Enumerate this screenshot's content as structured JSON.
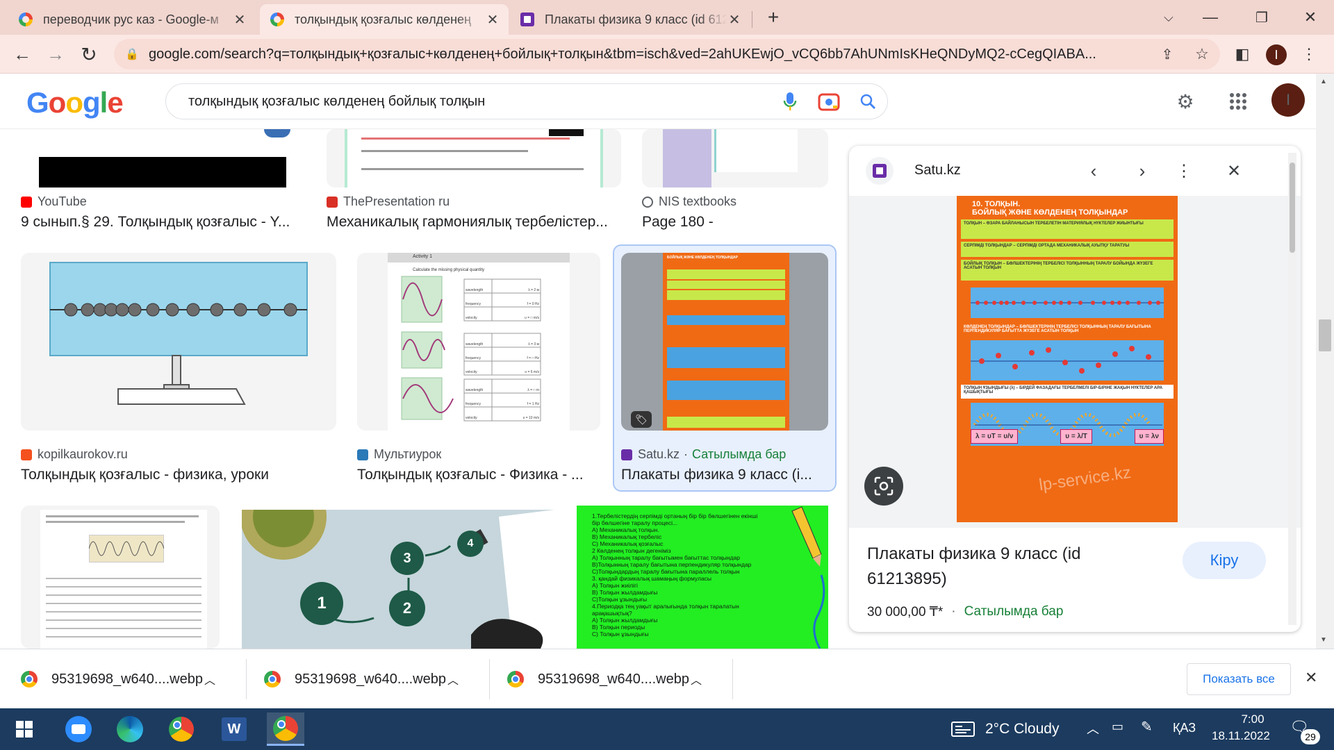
{
  "tabs": [
    {
      "title": "переводчик рус каз - Google-м",
      "active": false
    },
    {
      "title": "толқындық қозғалыс көлденең",
      "active": true
    },
    {
      "title": "Плакаты физика 9 класс (id 612",
      "active": false
    }
  ],
  "toolbar": {
    "url": "google.com/search?q=толқындық+қозғалыс+көлденең+бойлық+толқын&tbm=isch&ved=2ahUKEwjO_vCQ6bb7AhUNmIsKHeQNDyMQ2-cCegQIABA...",
    "profile_initial": "I"
  },
  "google": {
    "logo": [
      "G",
      "o",
      "o",
      "g",
      "l",
      "e"
    ],
    "logo_colors": [
      "#4285f4",
      "#ea4335",
      "#fbbc05",
      "#4285f4",
      "#34a853",
      "#ea4335"
    ],
    "query": "толқындық қозғалыс көлденең бойлық толқын",
    "profile_initial": "I"
  },
  "results_row1": [
    {
      "source": "YouTube",
      "caption": "9 сынып.§ 29. Толқындық қозғалыс - Y..."
    },
    {
      "source": "ThePresentation ru",
      "caption": "Механикалық гармониялық тербелістер..."
    },
    {
      "source": "NIS textbooks",
      "caption": "Page 180 -"
    }
  ],
  "results_row2": [
    {
      "source": "kopilkaurokov.ru",
      "caption": "Толқындық қозғалыс - физика, уроки"
    },
    {
      "source": "Мультиурок",
      "caption": "Толқындық қозғалыс - Физика - ..."
    },
    {
      "source": "Satu.kz",
      "source_extra": "Сатылымда бар",
      "caption": "Плакаты физика 9 класс (i..."
    }
  ],
  "thumb2": {
    "activity": "Activity 1",
    "instruction": "Calculate the missing physical quantity",
    "rows": [
      [
        "wavelength",
        "λ = 2 м"
      ],
      [
        "frequency",
        "f = 0 Hz"
      ],
      [
        "velocity",
        "υ = □ m/s"
      ],
      [
        "wavelength",
        "λ = 3 м"
      ],
      [
        "frequency",
        "f = □ Hz"
      ],
      [
        "velocity",
        "υ = 6 m/s"
      ],
      [
        "wavelength",
        "λ = □ m"
      ],
      [
        "frequency",
        "f = 1 Hz"
      ],
      [
        "velocity",
        "υ = 10 m/s"
      ]
    ]
  },
  "thumb3": {
    "lines": [
      "1.Тербелістердің серпімді ортаның бір бір бөлшегінен екінші",
      "бір бөлшегіне таралу процесі...",
      "А) Механикалық толқын.",
      "B) Механикалық тербеліс",
      "C) Механикалық қозғалыс",
      "2 Көлденең толқын дегеніміз",
      "A)  Толқынның таралу бағытымен бағыттас толқындар",
      "B)Толқынның таралу бағытына перпендикуляр толқындар",
      "C)Толқындардың таралу бағытына параллель толқын",
      "3. қандай физикалық шамаңың формуласы",
      "A) Толқын жиілігі",
      "B) Толқын жылдамдығы",
      "C)Толқын ұзындығы",
      "4.Периодқа тең уақыт аралығында толқын таралатын",
      "арақашықтық?",
      "A) Толқын  жылдамдығы",
      "B) Толқын периоды",
      "C) Толқын ұзындығы"
    ]
  },
  "diagram_numbers": [
    "1",
    "2",
    "3",
    "4"
  ],
  "poster": {
    "title1": "10. ТОЛҚЫН.",
    "title2": "БОЙЛЫҚ ЖӘНЕ КӨЛДЕНЕҢ ТОЛҚЫНДАР",
    "def1": "ТОЛҚЫН – ӨЗАРА БАЙЛАНЫСЫН ТЕРБЕЛЕТІН МАТЕРИЯЛЫҚ НҮКТЕЛЕР ЖИЫНТЫҒЫ",
    "def2": "СЕРПІМДІ ТОЛҚЫНДАР – СЕРПІМДІ ОРТАДА МЕХАНИКАЛЫҚ АУЫТҚУ ТАРАТУЫ",
    "def3": "БОЙЛЫҚ ТОЛҚЫН – БӨЛШЕКТЕРІНІҢ ТЕРБЕЛІСІ ТОЛҚЫННЫҢ ТАРАЛУ БОЙЫНДА ЖҮЗЕГЕ АСАТЫН ТОЛҚЫН",
    "def4": "КӨЛДЕНЕҢ ТОЛҚЫНДАР – БӨЛШЕКТЕРІНІҢ ТЕРБЕЛІСІ ТОЛҚЫННЫҢ ТАРАЛУ БАҒЫТЫНА ПЕРПЕНДИКУЛЯР БАҒЫТТА ЖҮЗЕГЕ АСАТЫН ТОЛҚЫН",
    "def5": "ТОЛҚЫН ҰЗЫНДЫҒЫ (λ) – БІРДЕЙ ФАЗАДАҒЫ ТЕРБЕЛМЕЛІ БІР-БІРІНЕ ЖАҚЫН НҮКТЕЛЕР АРА ҚАШЫҚТЫҒЫ",
    "f1": "λ = υT = υ/ν",
    "f2": "υ = λ/T",
    "f3": "υ = λν",
    "watermark": "lp-service.kz"
  },
  "panel": {
    "site": "Satu.kz",
    "title": "Плакаты физика 9 класс (id 61213895)",
    "price": "30 000,00 ₸*",
    "dot": "·",
    "availability": "Сатылымда бар",
    "visit_label": "Кіру"
  },
  "downloads": {
    "items": [
      "95319698_w640....webp",
      "95319698_w640....webp",
      "95319698_w640....webp"
    ],
    "show_all": "Показать все"
  },
  "taskbar": {
    "weather": "2°C  Cloudy",
    "lang": "ҚАЗ",
    "time": "7:00",
    "date": "18.11.2022",
    "notif_count": "29"
  },
  "colors": {
    "tabstrip": "#f1d5cf",
    "toolbar": "#fbe8e4",
    "link_blue": "#1a73e8",
    "satu_green": "#188038",
    "taskbar": "#1c3b5f",
    "poster_orange": "#f06a14"
  }
}
